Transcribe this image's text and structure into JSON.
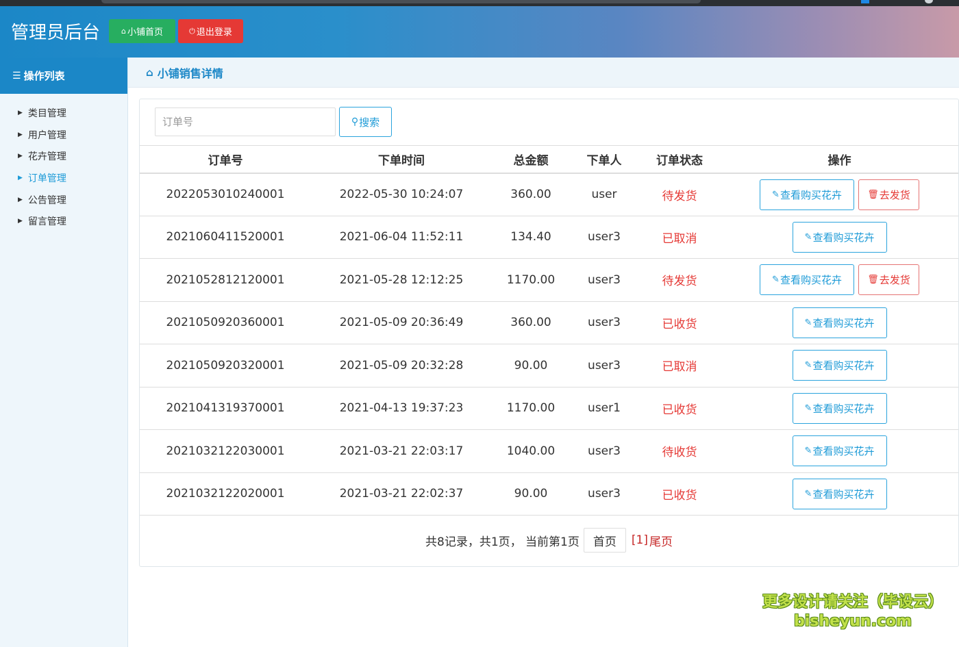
{
  "header": {
    "brand": "管理员后台",
    "home_button": "小铺首页",
    "logout_button": "退出登录"
  },
  "sidebar": {
    "title": "操作列表",
    "items": [
      {
        "label": "类目管理"
      },
      {
        "label": "用户管理"
      },
      {
        "label": "花卉管理"
      },
      {
        "label": "订单管理",
        "active": true
      },
      {
        "label": "公告管理"
      },
      {
        "label": "留言管理"
      }
    ]
  },
  "main": {
    "breadcrumb": "小铺销售详情",
    "search": {
      "placeholder": "订单号",
      "button": "搜索"
    },
    "table": {
      "headers": [
        "订单号",
        "下单时间",
        "总金额",
        "下单人",
        "订单状态",
        "操作"
      ],
      "rows": [
        {
          "order": "2022053010240001",
          "time": "2022-05-30 10:24:07",
          "amount": "360.00",
          "user": "user",
          "status": "待发货",
          "ship": true
        },
        {
          "order": "2021060411520001",
          "time": "2021-06-04 11:52:11",
          "amount": "134.40",
          "user": "user3",
          "status": "已取消",
          "ship": false
        },
        {
          "order": "2021052812120001",
          "time": "2021-05-28 12:12:25",
          "amount": "1170.00",
          "user": "user3",
          "status": "待发货",
          "ship": true
        },
        {
          "order": "2021050920360001",
          "time": "2021-05-09 20:36:49",
          "amount": "360.00",
          "user": "user3",
          "status": "已收货",
          "ship": false
        },
        {
          "order": "2021050920320001",
          "time": "2021-05-09 20:32:28",
          "amount": "90.00",
          "user": "user3",
          "status": "已取消",
          "ship": false
        },
        {
          "order": "2021041319370001",
          "time": "2021-04-13 19:37:23",
          "amount": "1170.00",
          "user": "user1",
          "status": "已收货",
          "ship": false
        },
        {
          "order": "2021032122030001",
          "time": "2021-03-21 22:03:17",
          "amount": "1040.00",
          "user": "user3",
          "status": "待收货",
          "ship": false
        },
        {
          "order": "2021032122020001",
          "time": "2021-03-21 22:02:37",
          "amount": "90.00",
          "user": "user3",
          "status": "已收货",
          "ship": false
        }
      ],
      "view_button": "查看购买花卉",
      "ship_button": "去发货"
    },
    "pager": {
      "summary": "共8记录，共1页，  当前第1页",
      "first": "首页",
      "current": "[1]",
      "last": "尾页"
    }
  },
  "watermark": {
    "line1": "更多设计请关注（毕设云）",
    "line2": "bisheyun.com"
  },
  "colors": {
    "accent": "#1b87c7",
    "success": "#27ae60",
    "danger": "#e53935",
    "link": "#1e9bd7"
  }
}
